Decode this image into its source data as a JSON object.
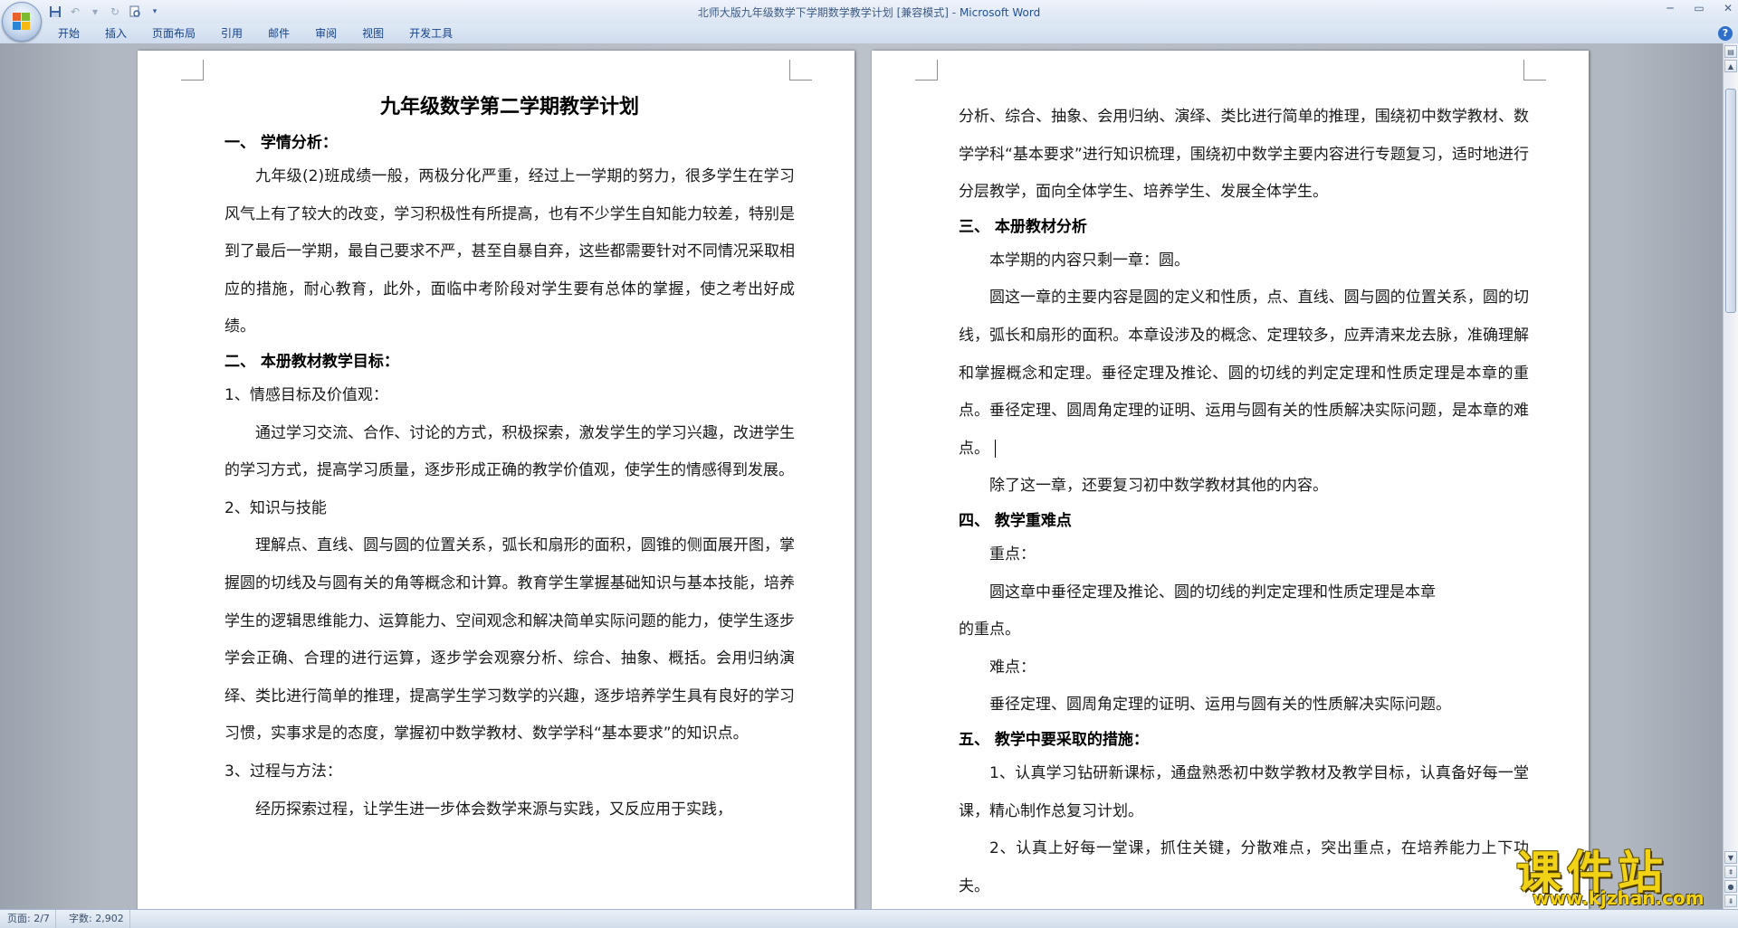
{
  "window": {
    "title_doc": "北师大版九年级数学下学期数学教学计划 [兼容模式]",
    "title_sep": " - ",
    "title_app": "Microsoft Word"
  },
  "ribbon": {
    "tabs": [
      "开始",
      "插入",
      "页面布局",
      "引用",
      "邮件",
      "审阅",
      "视图",
      "开发工具"
    ]
  },
  "page_left": {
    "title": "九年级数学第二学期教学计划",
    "blocks": [
      {
        "type": "heading",
        "text": "一、  学情分析："
      },
      {
        "type": "para",
        "style": "indent",
        "text": "九年级(2)班成绩一般，两极分化严重，经过上一学期的努力，很多学生在学习风气上有了较大的改变，学习积极性有所提高，也有不少学生自知能力较差，特别是到了最后一学期，最自己要求不严，甚至自暴自弃，这些都需要针对不同情况采取相应的措施，耐心教育，此外，面临中考阶段对学生要有总体的掌握，使之考出好成绩。"
      },
      {
        "type": "heading",
        "text": "二、  本册教材教学目标："
      },
      {
        "type": "para",
        "style": "plain",
        "text": "1、情感目标及价值观："
      },
      {
        "type": "para",
        "style": "indent",
        "text": "通过学习交流、合作、讨论的方式，积极探索，激发学生的学习兴趣，改进学生的学习方式，提高学习质量，逐步形成正确的教学价值观，使学生的情感得到发展。"
      },
      {
        "type": "para",
        "style": "plain",
        "text": "2、知识与技能"
      },
      {
        "type": "para",
        "style": "indent",
        "text": "理解点、直线、圆与圆的位置关系，弧长和扇形的面积，圆锥的侧面展开图，掌握圆的切线及与圆有关的角等概念和计算。教育学生掌握基础知识与基本技能，培养学生的逻辑思维能力、运算能力、空间观念和解决简单实际问题的能力，使学生逐步学会正确、合理的进行运算，逐步学会观察分析、综合、抽象、概括。会用归纳演绎、类比进行简单的推理，提高学生学习数学的兴趣，逐步培养学生具有良好的学习习惯，实事求是的态度，掌握初中数学教材、数学学科“基本要求”的知识点。"
      },
      {
        "type": "para",
        "style": "plain",
        "text": "3、过程与方法："
      },
      {
        "type": "para",
        "style": "indent",
        "text": "经历探索过程，让学生进一步体会数学来源与实践，又反应用于实践，"
      }
    ]
  },
  "page_right": {
    "blocks": [
      {
        "type": "para",
        "style": "plain",
        "text": "分析、综合、抽象、会用归纳、演绎、类比进行简单的推理，围绕初中数学教材、数学学科“基本要求”进行知识梳理，围绕初中数学主要内容进行专题复习，适时地进行分层教学，面向全体学生、培养学生、发展全体学生。"
      },
      {
        "type": "heading",
        "text": "三、  本册教材分析"
      },
      {
        "type": "para",
        "style": "indent",
        "text": "本学期的内容只剩一章：圆。"
      },
      {
        "type": "para",
        "style": "indent",
        "text": "圆这一章的主要内容是圆的定义和性质，点、直线、圆与圆的位置关系，圆的切线，弧长和扇形的面积。本章设涉及的概念、定理较多，应弄清来龙去脉，准确理解和掌握概念和定理。垂径定理及推论、圆的切线的判定定理和性质定理是本章的重点。垂径定理、圆周角定理的证明、运用与圆有关的性质解决实际问题，是本章的难点。",
        "cursor": true
      },
      {
        "type": "para",
        "style": "indent",
        "text": "除了这一章，还要复习初中数学教材其他的内容。"
      },
      {
        "type": "heading",
        "text": "四、  教学重难点"
      },
      {
        "type": "para",
        "style": "pad",
        "text": " 重点："
      },
      {
        "type": "para",
        "style": "pad",
        "text": " 圆这章中垂径定理及推论、圆的切线的判定定理和性质定理是本章"
      },
      {
        "type": "para",
        "style": "plain",
        "text": "的重点。"
      },
      {
        "type": "para",
        "style": "indent",
        "text": "难点："
      },
      {
        "type": "para",
        "style": "indent",
        "text": "垂径定理、圆周角定理的证明、运用与圆有关的性质解决实际问题。"
      },
      {
        "type": "heading",
        "text": "五、  教学中要采取的措施："
      },
      {
        "type": "para",
        "style": "indent",
        "text": "1、认真学习钻研新课标，通盘熟悉初中数学教材及教学目标，认真备好每一堂课，精心制作总复习计划。"
      },
      {
        "type": "para",
        "style": "indent",
        "text": "2、认真上好每一堂课，抓住关键，分散难点，突出重点，在培养能力上下功夫。"
      }
    ]
  },
  "statusbar": {
    "page": "页面: 2/7",
    "words": "字数: 2,902"
  },
  "watermark": {
    "main": "课件站",
    "url": "www.kjzhan.com"
  }
}
